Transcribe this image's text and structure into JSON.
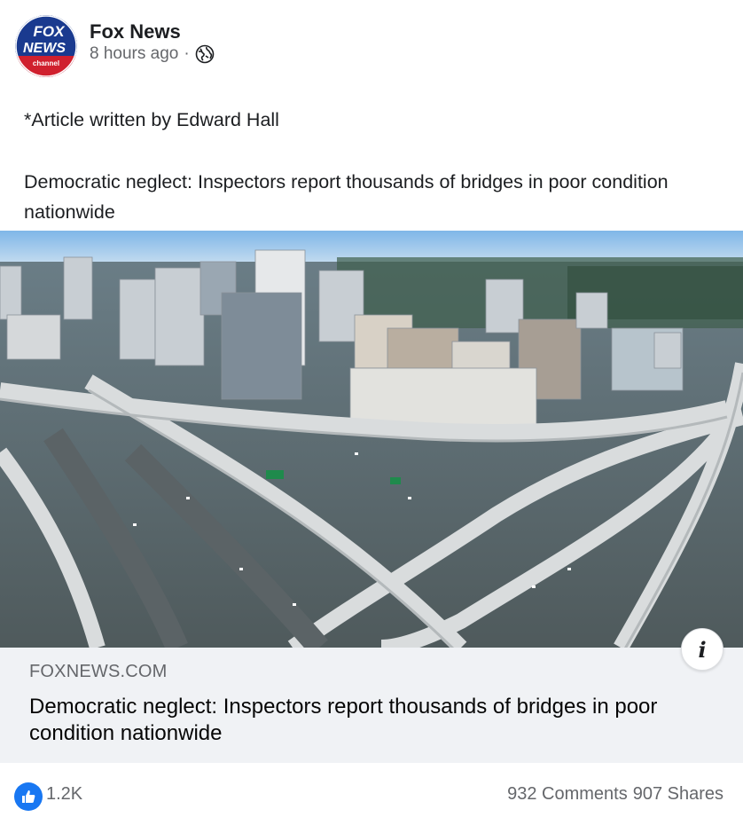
{
  "post": {
    "page_name": "Fox News",
    "timestamp": "8 hours ago",
    "separator": "·",
    "audience_icon": "globe-icon",
    "avatar": {
      "line1": "FOX",
      "line2": "NEWS",
      "line3": "channel",
      "colors": {
        "blue": "#1a3a8f",
        "red": "#d0202e",
        "white": "#ffffff"
      }
    },
    "text_line1": "*Article written by Edward Hall",
    "text_line2": "Democratic neglect: Inspectors report thousands of bridges in poor condition nationwide"
  },
  "link_preview": {
    "domain": "FOXNEWS.COM",
    "title": "Democratic neglect: Inspectors report thousands of bridges in poor condition nationwide",
    "info_icon": "info-icon",
    "info_label": "i"
  },
  "engagement": {
    "reaction_icon": "thumbs-up-icon",
    "reaction_count": "1.2K",
    "comments": "932 Comments",
    "shares": "907 Shares"
  },
  "colors": {
    "brand_blue": "#1877f2",
    "secondary_text": "#65676b",
    "card_bg": "#f0f2f5"
  }
}
